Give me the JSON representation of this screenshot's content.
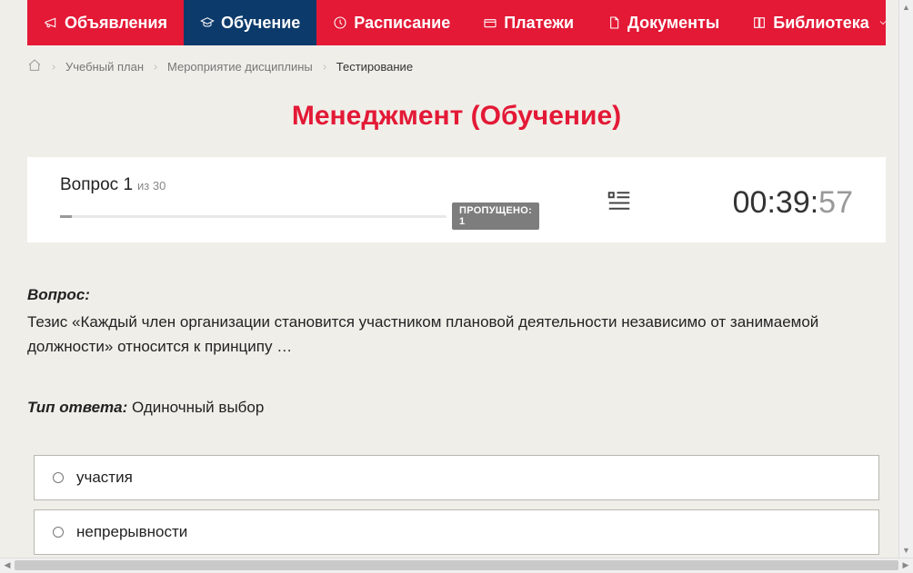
{
  "nav": {
    "items": [
      {
        "label": "Объявления",
        "icon": "megaphone"
      },
      {
        "label": "Обучение",
        "icon": "graduation",
        "active": true
      },
      {
        "label": "Расписание",
        "icon": "clock"
      },
      {
        "label": "Платежи",
        "icon": "payment"
      },
      {
        "label": "Документы",
        "icon": "document"
      },
      {
        "label": "Библиотека",
        "icon": "book",
        "dropdown": true
      }
    ]
  },
  "breadcrumb": {
    "items": [
      {
        "label": "Учебный план"
      },
      {
        "label": "Мероприятие дисциплины"
      },
      {
        "label": "Тестирование",
        "current": true
      }
    ]
  },
  "page_title": "Менеджмент (Обучение)",
  "status": {
    "question_label": "Вопрос 1",
    "of_label": "из 30",
    "skipped_badge": "ПРОПУЩЕНО: 1",
    "timer_main": "00:39:",
    "timer_sec": "57"
  },
  "question": {
    "label": "Вопрос:",
    "text": "Тезис «Каждый член организации становится участником плановой деятельности независимо от занимаемой должности» относится к принципу …"
  },
  "answer_type": {
    "label": "Тип ответа:",
    "value": " Одиночный выбор"
  },
  "answers": [
    {
      "text": "участия"
    },
    {
      "text": "непрерывности"
    }
  ]
}
